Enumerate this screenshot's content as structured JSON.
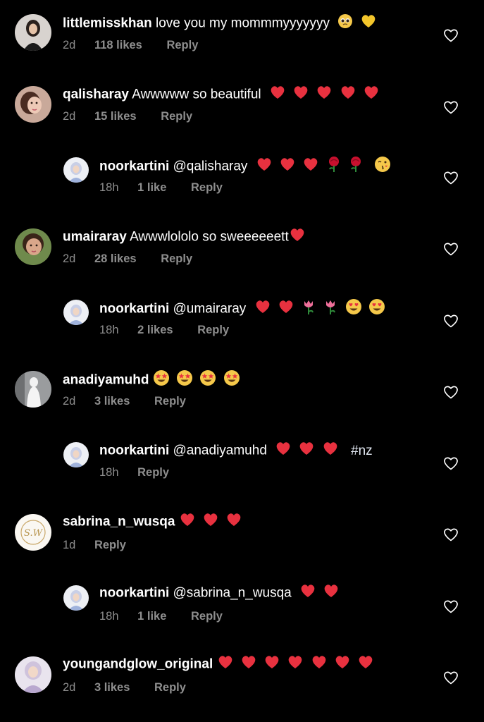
{
  "comments": [
    {
      "username": "littlemisskhan",
      "text": "love you my mommmyyyyyyy",
      "emojis": [
        "pleading-face",
        "yellow-heart"
      ],
      "age": "2d",
      "likes": "118 likes",
      "reply": "Reply",
      "type": "main"
    },
    {
      "username": "qalisharay",
      "text": "Awwwww so beautiful",
      "emojis": [
        "red-heart",
        "red-heart",
        "red-heart",
        "red-heart",
        "red-heart"
      ],
      "age": "2d",
      "likes": "15 likes",
      "reply": "Reply",
      "type": "main"
    },
    {
      "username": "noorkartini",
      "text": "@qalisharay",
      "emojis": [
        "red-heart",
        "red-heart",
        "red-heart",
        "rose",
        "rose",
        "kissing-face"
      ],
      "age": "18h",
      "likes": "1 like",
      "reply": "Reply",
      "type": "reply"
    },
    {
      "username": "umairaray",
      "text": "Awwwlololo so sweeeeeett",
      "emojis": [
        "red-heart"
      ],
      "age": "2d",
      "likes": "28 likes",
      "reply": "Reply",
      "type": "main"
    },
    {
      "username": "noorkartini",
      "text": "@umairaray",
      "emojis": [
        "red-heart",
        "red-heart",
        "tulip",
        "tulip",
        "heart-eyes",
        "heart-eyes"
      ],
      "age": "18h",
      "likes": "2 likes",
      "reply": "Reply",
      "type": "reply"
    },
    {
      "username": "anadiyamuhd",
      "text": "",
      "emojis": [
        "star-struck",
        "star-struck",
        "star-struck",
        "star-struck"
      ],
      "age": "2d",
      "likes": "3 likes",
      "reply": "Reply",
      "type": "main"
    },
    {
      "username": "noorkartini",
      "text": "@anadiyamuhd",
      "emojis": [
        "red-heart",
        "red-heart",
        "red-heart"
      ],
      "hashtag": "#nz",
      "age": "18h",
      "likes": "",
      "reply": "Reply",
      "type": "reply"
    },
    {
      "username": "sabrina_n_wusqa",
      "text": "",
      "emojis": [
        "red-heart",
        "red-heart",
        "red-heart"
      ],
      "age": "1d",
      "likes": "",
      "reply": "Reply",
      "type": "main"
    },
    {
      "username": "noorkartini",
      "text": "@sabrina_n_wusqa",
      "emojis": [
        "red-heart",
        "red-heart"
      ],
      "age": "18h",
      "likes": "1 like",
      "reply": "Reply",
      "type": "reply"
    },
    {
      "username": "youngandglow_original",
      "text": "",
      "emojis": [
        "red-heart",
        "red-heart",
        "red-heart",
        "red-heart",
        "red-heart",
        "red-heart",
        "red-heart"
      ],
      "age": "2d",
      "likes": "3 likes",
      "reply": "Reply",
      "type": "main"
    }
  ],
  "icons": {
    "like": "heart-outline-icon"
  },
  "colors": {
    "background": "#000000",
    "primary_text": "#ffffff",
    "secondary_text": "#8e8e8e",
    "heart_red": "#e8313f"
  },
  "avatar_monogram": "S.W"
}
